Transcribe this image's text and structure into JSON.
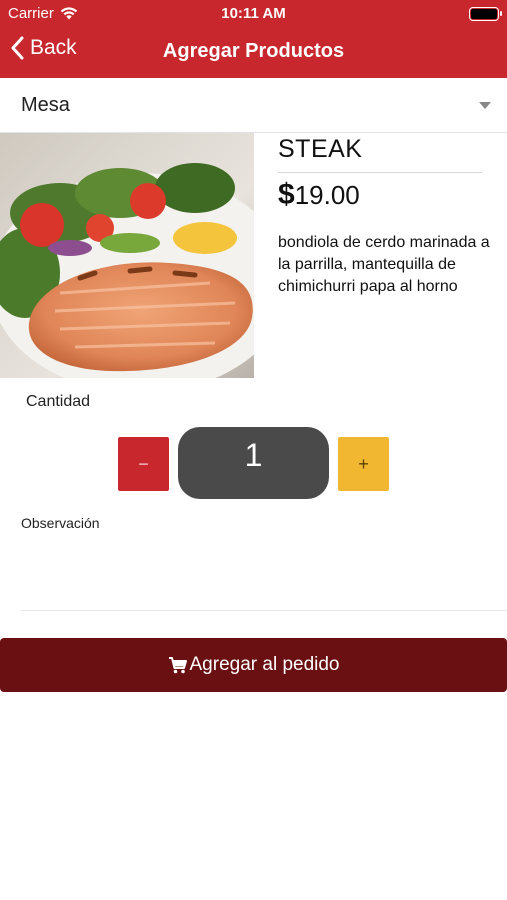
{
  "status_bar": {
    "carrier": "Carrier",
    "time": "10:11 AM"
  },
  "nav": {
    "back_label": "Back",
    "title": "Agregar Productos"
  },
  "mesa": {
    "label": "Mesa"
  },
  "product": {
    "name": "STEAK",
    "currency_symbol": "$",
    "price": "19.00",
    "description": "bondiola de cerdo marinada a la parrilla, mantequilla de chimichurri papa al horno"
  },
  "quantity": {
    "label": "Cantidad",
    "minus": "−",
    "value": "1",
    "plus": "+"
  },
  "observacion": {
    "label": "Observación",
    "value": ""
  },
  "add_button": {
    "label": "Agregar al pedido",
    "icon": "cart-icon"
  },
  "colors": {
    "header": "#c8272e",
    "add_button": "#6a0f12",
    "minus_button": "#c8272e",
    "plus_button": "#f2b731",
    "quantity_display": "#4a4a4a"
  }
}
